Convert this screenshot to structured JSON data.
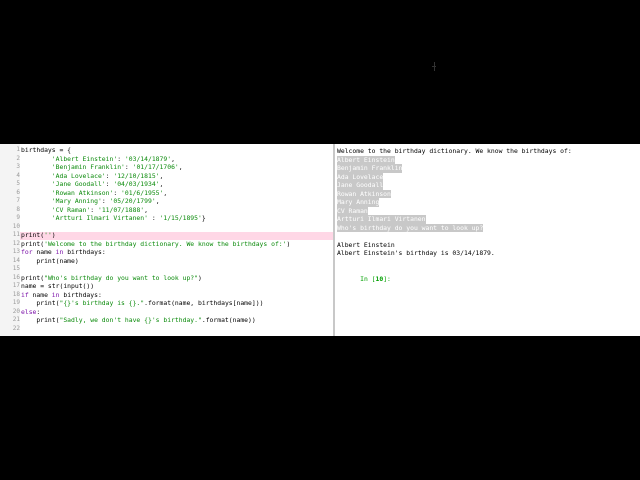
{
  "editor": {
    "current_line": 11,
    "lines": [
      {
        "no": "1",
        "text": "birthdays = {"
      },
      {
        "no": "2",
        "text": "        'Albert Einstein': '03/14/1879',"
      },
      {
        "no": "3",
        "text": "        'Benjamin Franklin': '01/17/1706',"
      },
      {
        "no": "4",
        "text": "        'Ada Lovelace': '12/10/1815',"
      },
      {
        "no": "5",
        "text": "        'Jane Goodall': '04/03/1934',"
      },
      {
        "no": "6",
        "text": "        'Rowan Atkinson': '01/6/1955',"
      },
      {
        "no": "7",
        "text": "        'Mary Anning': '05/20/1799',"
      },
      {
        "no": "8",
        "text": "        'CV Raman': '11/07/1888',"
      },
      {
        "no": "9",
        "text": "        'Artturi Ilmari Virtanen' : '1/15/1895'}"
      },
      {
        "no": "10",
        "text": ""
      },
      {
        "no": "11",
        "text": "print('')"
      },
      {
        "no": "12",
        "text": "print('Welcome to the birthday dictionary. We know the birthdays of:')"
      },
      {
        "no": "13",
        "text": "for name in birthdays:"
      },
      {
        "no": "14",
        "text": "    print(name)"
      },
      {
        "no": "15",
        "text": ""
      },
      {
        "no": "16",
        "text": "print(\"Who's birthday do you want to look up?\")"
      },
      {
        "no": "17",
        "text": "name = str(input())"
      },
      {
        "no": "18",
        "text": "if name in birthdays:"
      },
      {
        "no": "19",
        "text": "    print(\"{}'s birthday is {}.\".format(name, birthdays[name]))"
      },
      {
        "no": "20",
        "text": "else:"
      },
      {
        "no": "21",
        "text": "    print(\"Sadly, we don't have {}'s birthday.\".format(name))"
      },
      {
        "no": "22",
        "text": ""
      }
    ]
  },
  "console": {
    "welcome": "Welcome to the birthday dictionary. We know the birthdays of:",
    "selected_lines": [
      "Albert Einstein",
      "Benjamin Franklin",
      "Ada Lovelace",
      "Jane Goodall",
      "Rowan Atkinson",
      "Mary Anning",
      "CV Raman",
      "Artturi Ilmari Virtanen",
      "Who's birthday do you want to look up?"
    ],
    "user_input": "Albert Einstein",
    "result": "Albert Einstein's birthday is 03/14/1879.",
    "prompt_prefix": "In [",
    "prompt_number": "10",
    "prompt_suffix": "]:"
  }
}
